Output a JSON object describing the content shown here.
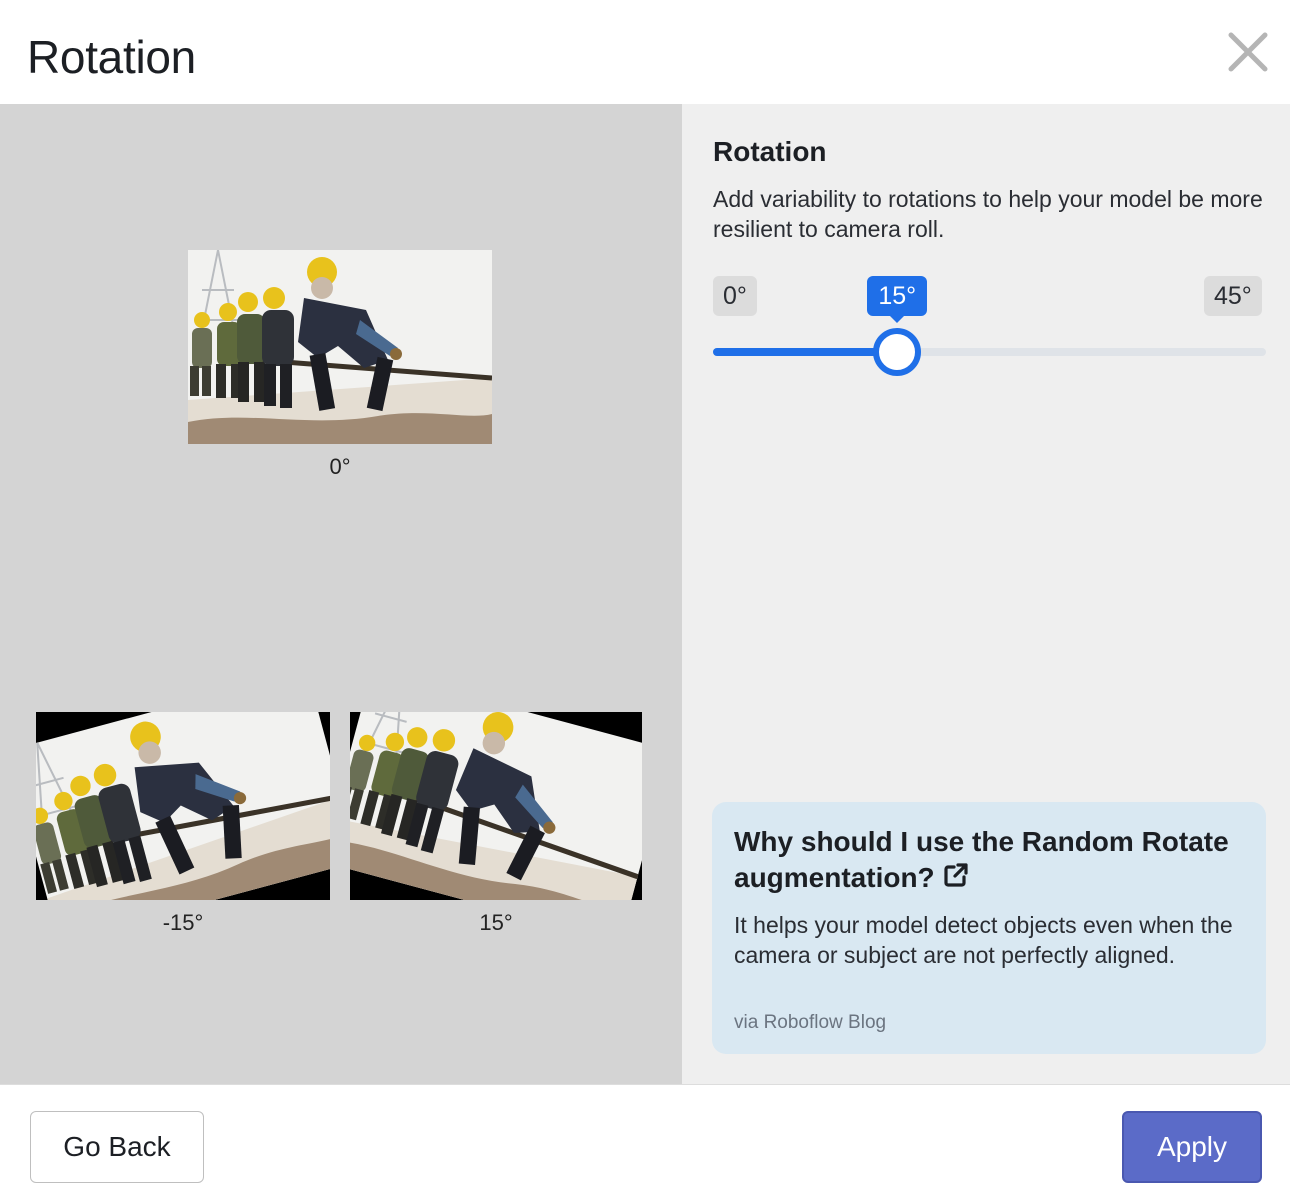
{
  "modal": {
    "title": "Rotation",
    "close_icon": "close-icon"
  },
  "preview": {
    "original_caption": "0°",
    "variants": [
      {
        "caption": "-15°",
        "angle_deg": -15
      },
      {
        "caption": "15°",
        "angle_deg": 15
      }
    ]
  },
  "settings": {
    "title": "Rotation",
    "description": "Add variability to rotations to help your model be more resilient to camera roll.",
    "slider": {
      "min_label": "0°",
      "max_label": "45°",
      "value_label": "15°",
      "min": 0,
      "max": 45,
      "value": 15
    }
  },
  "info_card": {
    "title": "Why should I use the Random Rotate augmentation?",
    "link_icon": "external-link-icon",
    "body": "It helps your model detect objects even when the camera or subject are not perfectly aligned.",
    "source": "via Roboflow Blog"
  },
  "footer": {
    "back_label": "Go Back",
    "apply_label": "Apply"
  },
  "colors": {
    "accent": "#1f6fe8",
    "apply_button": "#5b6bc8",
    "preview_bg": "#d4d4d4",
    "settings_bg": "#efefef",
    "info_card_bg": "#d9e8f2"
  }
}
